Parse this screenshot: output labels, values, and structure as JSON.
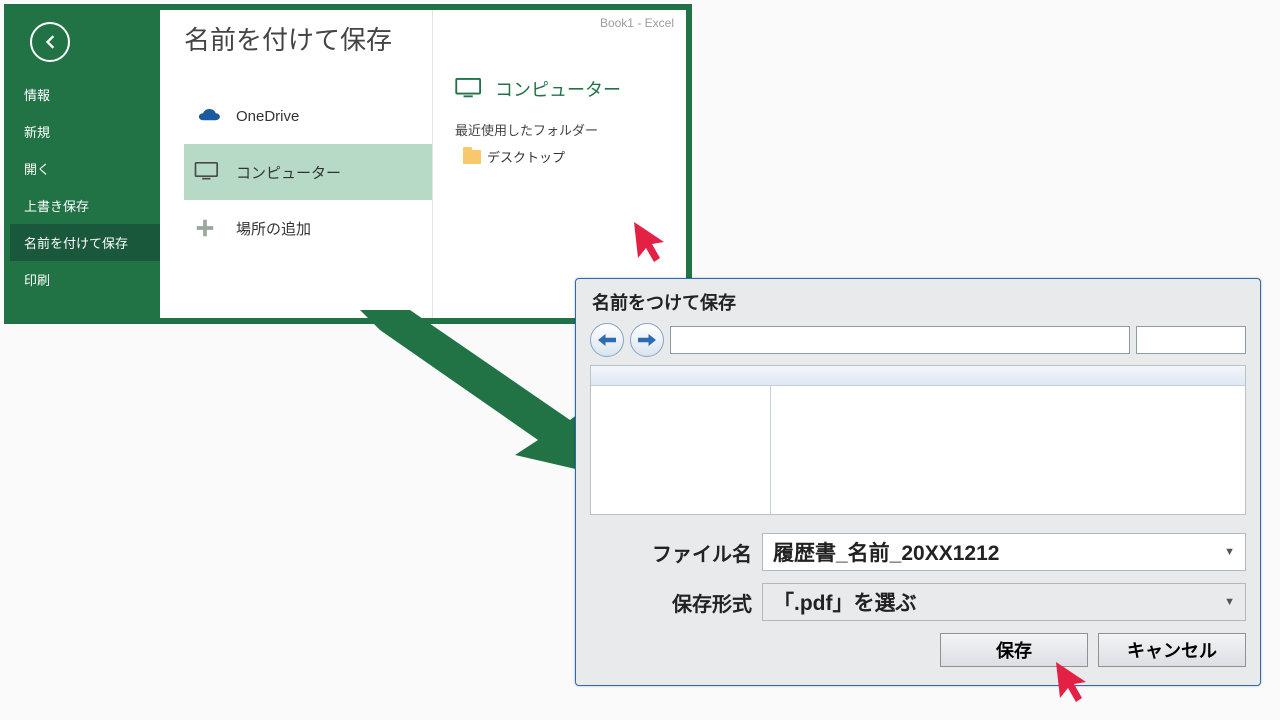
{
  "backstage": {
    "app_title": "Book1 - Excel",
    "sidebar": {
      "items": [
        {
          "label": "情報"
        },
        {
          "label": "新規"
        },
        {
          "label": "開く"
        },
        {
          "label": "上書き保存"
        },
        {
          "label": "名前を付けて保存"
        },
        {
          "label": "印刷"
        }
      ],
      "active_index": 4
    },
    "page_title": "名前を付けて保存",
    "locations": {
      "onedrive": "OneDrive",
      "computer": "コンピューター",
      "add_place": "場所の追加"
    },
    "selected_location": "computer",
    "right_panel": {
      "heading": "コンピューター",
      "recent_heading": "最近使用したフォルダー",
      "recent_items": [
        "デスクトップ"
      ]
    }
  },
  "dialog": {
    "title": "名前をつけて保存",
    "filename_label": "ファイル名",
    "filename_value": "履歴書_名前_20XX1212",
    "filetype_label": "保存形式",
    "filetype_value": "「.pdf」を選ぶ",
    "buttons": {
      "save": "保存",
      "cancel": "キャンセル"
    }
  }
}
